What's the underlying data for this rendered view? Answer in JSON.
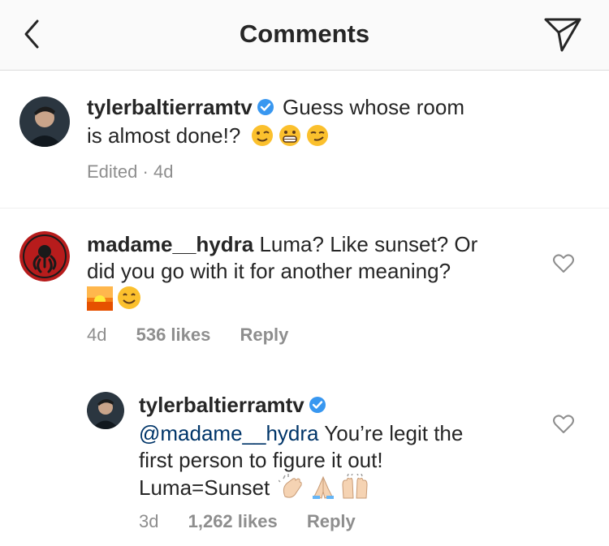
{
  "header": {
    "title": "Comments"
  },
  "caption": {
    "username": "tylerbaltierramtv",
    "text_line1": "Guess whose room",
    "text_line2": "is almost done!?",
    "emojis": [
      "winking-face",
      "grimacing-face",
      "smirking-face"
    ],
    "edited": "Edited",
    "separator": "·",
    "time": "4d"
  },
  "comments": [
    {
      "username": "madame__hydra",
      "line1": "Luma? Like sunset? Or",
      "line2": "did you go with it for another meaning?",
      "emojis": [
        "sunset-emoji",
        "smiling-face"
      ],
      "time": "4d",
      "likes": "536 likes",
      "reply": "Reply"
    },
    {
      "username": "tylerbaltierramtv",
      "mention": "@madame__hydra",
      "line1_rest": "You’re legit the",
      "line2": "first person to figure it out!",
      "line3": "Luma=Sunset",
      "emojis": [
        "clapping-hands",
        "folded-hands",
        "raising-hands"
      ],
      "time": "3d",
      "likes": "1,262 likes",
      "reply": "Reply"
    }
  ],
  "colors": {
    "verified": "#3897f0",
    "mention": "#003569",
    "meta": "#8e8e8e"
  }
}
